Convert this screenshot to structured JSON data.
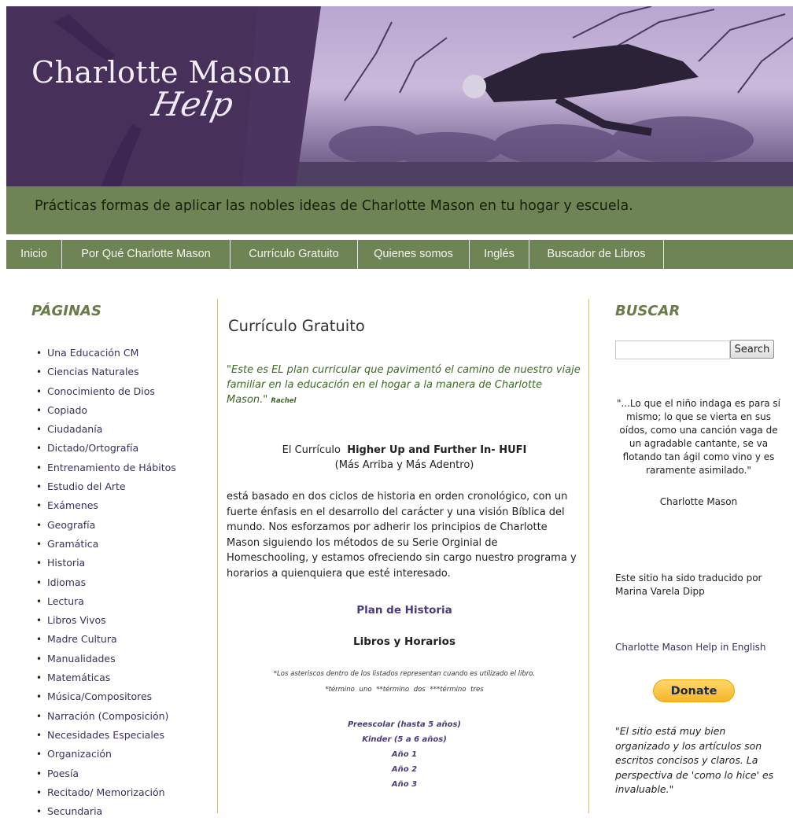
{
  "header": {
    "site_title": "Charlotte Mason",
    "site_script": "Help",
    "tagline": "Prácticas formas de aplicar las nobles ideas de Charlotte Mason en tu hogar y escuela."
  },
  "nav": {
    "items": [
      "Inicio",
      "Por Qué Charlotte Mason",
      "Currículo Gratuito",
      "Quienes somos",
      "Inglés",
      "Buscador de Libros"
    ]
  },
  "sidebar_left": {
    "title": "PÁGINAS",
    "items": [
      "Una Educación CM",
      "Ciencias Naturales",
      "Conocimiento de Dios",
      "Copiado",
      "Ciudadanía",
      "Dictado/Ortografía",
      "Entrenamiento de Hábitos",
      "Estudio del Arte",
      "Exámenes",
      "Geografía",
      "Gramática",
      "Historia",
      "Idiomas",
      "Lectura",
      "Libros Vivos",
      "Madre Cultura",
      "Manualidades",
      "Matemáticas",
      "Música/Compositores",
      "Narración (Composición)",
      "Necesidades Especiales",
      "Organización",
      "Poesía",
      "Recitado/ Memorización",
      "Secundaria"
    ]
  },
  "main": {
    "post_title": "Currículo Gratuito",
    "intro_quote": "\"Este es EL plan curricular que pavimentó el camino de nuestro viaje familiar en la educación en el hogar a la manera de Charlotte Mason.\"",
    "intro_author": "Rachel",
    "curriculum_prefix": "El Currículo",
    "curriculum_name": "Higher Up and Further In- HUFI",
    "curriculum_translation": "(Más Arriba y Más Adentro)",
    "description": "está basado en dos ciclos de historia en orden cronológico, con un fuerte énfasis en el desarrollo del carácter y una visión Bíblica del mundo. Nos esforzamos por adherir los principios de Charlotte Mason siguiendo los métodos de su Serie Orginial de Homeschooling, y estamos ofreciendo sin cargo nuestro programa y horarios a quienquiera que esté interesado.",
    "history_plan": "Plan de Historia",
    "books_schedules": "Libros y Horarios",
    "asterisk_note": "*Los asteriscos dentro de los listados representan  cuando es utilizado el libro.",
    "terms_note": "*término uno   **término dos   ***término tres",
    "years": [
      "Preescolar (hasta 5 años)",
      "Kinder (5 a 6 años)",
      "Año 1",
      "Año 2",
      "Año 3"
    ]
  },
  "sidebar_right": {
    "title": "BUSCAR",
    "search_button": "Search",
    "cm_quote": "\"...Lo que el niño indaga es para sí mismo; lo que se vierta en sus oídos, como una canción vaga de un agradable cantante, se va flotando tan ágil como vino y es raramente asimilado.\"",
    "cm_author": "Charlotte Mason",
    "translated_by": "Este sitio ha sido traducido por Marina Varela Dipp",
    "english_link": "Charlotte Mason Help in English",
    "donate_label": "Donate",
    "testimonial": "\"El sitio está muy bien organizado y los artículos son escritos concisos y claros. La perspectiva de 'como lo hice' es invaluable.\""
  },
  "colors": {
    "header_purple": "#3f2a52",
    "green_band": "#6e8455",
    "link_purple": "#4a3a7c",
    "heading_green": "#6a7b4a",
    "quote_green": "#3c6a24"
  }
}
